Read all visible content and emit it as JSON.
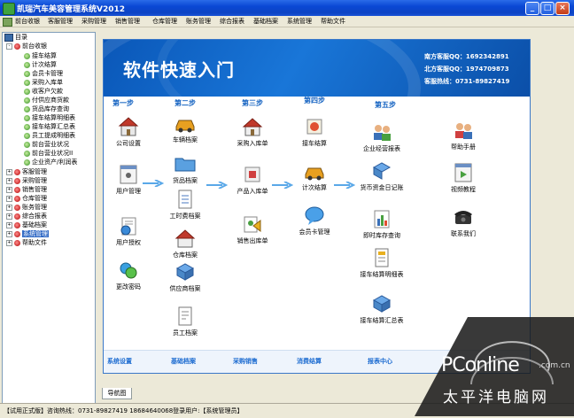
{
  "window": {
    "title": "凯瑞汽车美容管理系统V2012"
  },
  "menu": [
    "前台收银",
    "客服管理",
    "采购管理",
    "销售管理",
    "仓库管理",
    "账务管理",
    "综合报表",
    "基础档案",
    "系统管理",
    "帮助文件"
  ],
  "tree": {
    "root": "目录",
    "group_open": "前台收银",
    "children": [
      "接车结算",
      "计次结算",
      "会员卡管理",
      "采购入库单",
      "收客户欠款",
      "付供应商货款",
      "货品库存查询",
      "接车结算明细表",
      "接车结算汇总表",
      "员工提成明细表",
      "前台营业状况",
      "前台营业状况II",
      "企业资产/利润表"
    ],
    "groups": [
      "客服管理",
      "采购管理",
      "销售管理",
      "仓库管理",
      "账务管理",
      "综合报表",
      "基础档案",
      "系统管理",
      "帮助文件"
    ],
    "selected": "系统管理"
  },
  "banner": {
    "title": "软件快速入门",
    "south_qq": "南方客服QQ：1692342891",
    "north_qq": "北方客服QQ：1974709873",
    "hotline": "客服热线：0731-89827419"
  },
  "steps": [
    "第一步",
    "第二步",
    "第三步",
    "第四步",
    "第五步"
  ],
  "col1": [
    "公司设置",
    "用户管理",
    "用户授权",
    "更改密码"
  ],
  "col2": [
    "车辆档案",
    "货品档案",
    "工时费档案",
    "仓库档案",
    "供应商档案",
    "员工档案"
  ],
  "col3": [
    "采购入库单",
    "产品入库单",
    "销售出库单"
  ],
  "col4": [
    "接车结算",
    "计次结算",
    "会员卡管理"
  ],
  "col5": [
    "企业经营报表",
    "货币资金日记账",
    "即时库存查询",
    "接车结算明细表",
    "接车结算汇总表"
  ],
  "col6": [
    "帮助手册",
    "视频教程",
    "联系我们"
  ],
  "sections": [
    "系统设置",
    "基础档案",
    "采购销售",
    "消费结算",
    "报表中心"
  ],
  "tab": "导航图",
  "status": "【试用正式版】咨询热线：0731-89827419 18684640068登录用户:【系统管理员】",
  "watermark": {
    "brand": "PConline",
    "domain": ".com.cn",
    "cn": "太平洋电脑网"
  }
}
